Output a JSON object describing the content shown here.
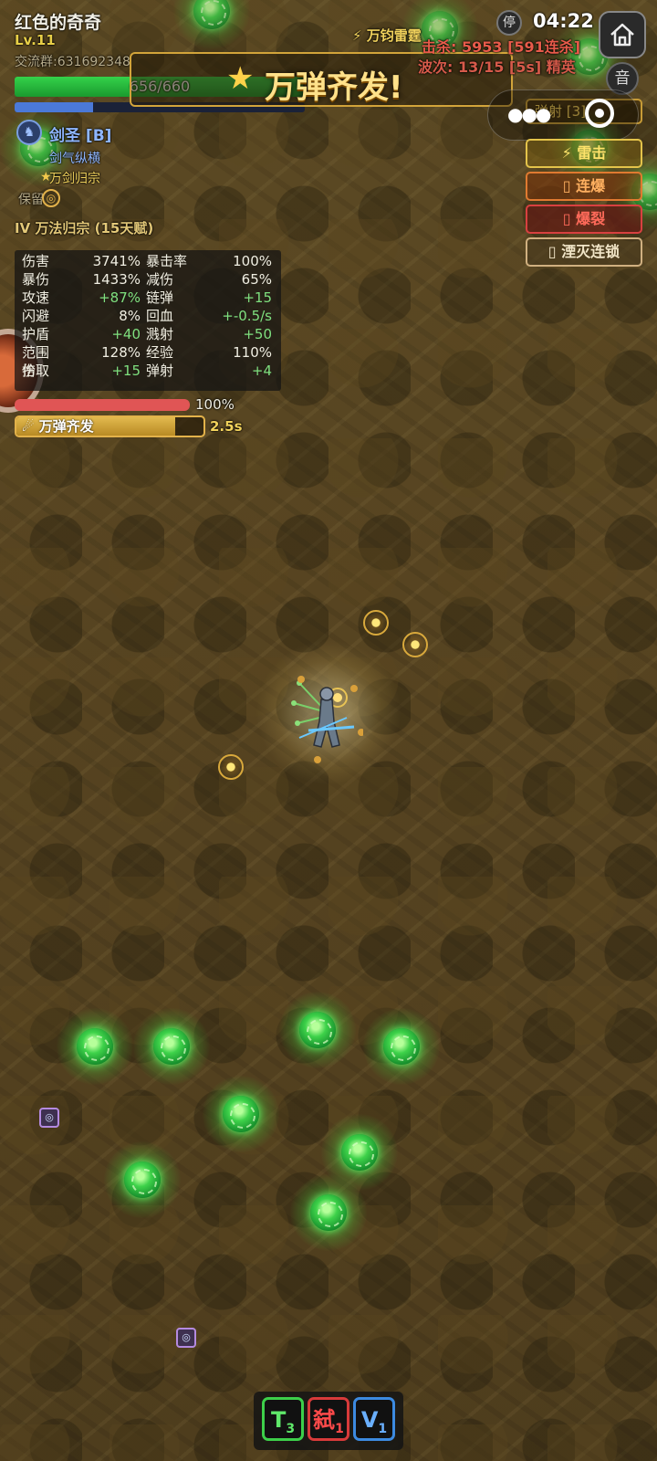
{
  "player": {
    "name": "红色的奇奇",
    "level": "Lv.11",
    "id_text": "交流群:631692348",
    "hp_text": "656/660",
    "hp_fraction": 0.994,
    "xp_fraction": 0.27,
    "class_name": "剑圣 [B]",
    "class_icon": "swordsman-icon",
    "skills": [
      "剑气纵横",
      "万剑归宗"
    ],
    "guard_label": "保留",
    "talent": "IV 万法归宗 (15天赋)"
  },
  "stats": [
    {
      "k1": "伤害",
      "v1": "3741%",
      "k2": "暴击率",
      "v2": "100%"
    },
    {
      "k1": "暴伤",
      "v1": "1433%",
      "k2": "减伤",
      "v2": "65%"
    },
    {
      "k1": "攻速",
      "v1": "+87%",
      "k2": "链弹",
      "v2": "+15"
    },
    {
      "k1": "闪避",
      "v1": "8%",
      "k2": "回血",
      "v2": "+-0.5/s"
    },
    {
      "k1": "护盾",
      "v1": "+40",
      "k2": "溅射",
      "v2": "+50"
    },
    {
      "k1": "范围伤",
      "v1": "128%",
      "k2": "经验",
      "v2": "110%"
    },
    {
      "k1": "拾取",
      "v1": "+15",
      "k2": "弹射",
      "v2": "+4"
    }
  ],
  "shield": {
    "fraction": 1.0,
    "text": "100%"
  },
  "ultimate": {
    "label": "万弹齐发",
    "fraction": 0.85,
    "time": "2.5s"
  },
  "banner": {
    "text": "万弹齐发!",
    "icon": "star-swirl-icon"
  },
  "hud": {
    "pause_label": "停",
    "timer": "04:22",
    "sound_label": "音",
    "weapon": "⚡ 万钧雷霆",
    "kills": "击杀: 5953 [591连杀]",
    "wave": "波次: 13/15 [5s] 精英",
    "buff_tag": "弹射 [3]"
  },
  "affixes": [
    "⚡ 雷击",
    "▯ 连爆",
    "▯ 爆裂",
    "▯ 湮灭连锁"
  ],
  "bottom_skills": [
    {
      "letter": "T",
      "count": "3"
    },
    {
      "letter": "弑",
      "count": "1"
    },
    {
      "letter": "V",
      "count": "1"
    }
  ],
  "colors": {
    "hp": "#2bc640",
    "xp": "#4b79d8",
    "gold": "#e3b24a",
    "kills": "#e85a4a"
  }
}
